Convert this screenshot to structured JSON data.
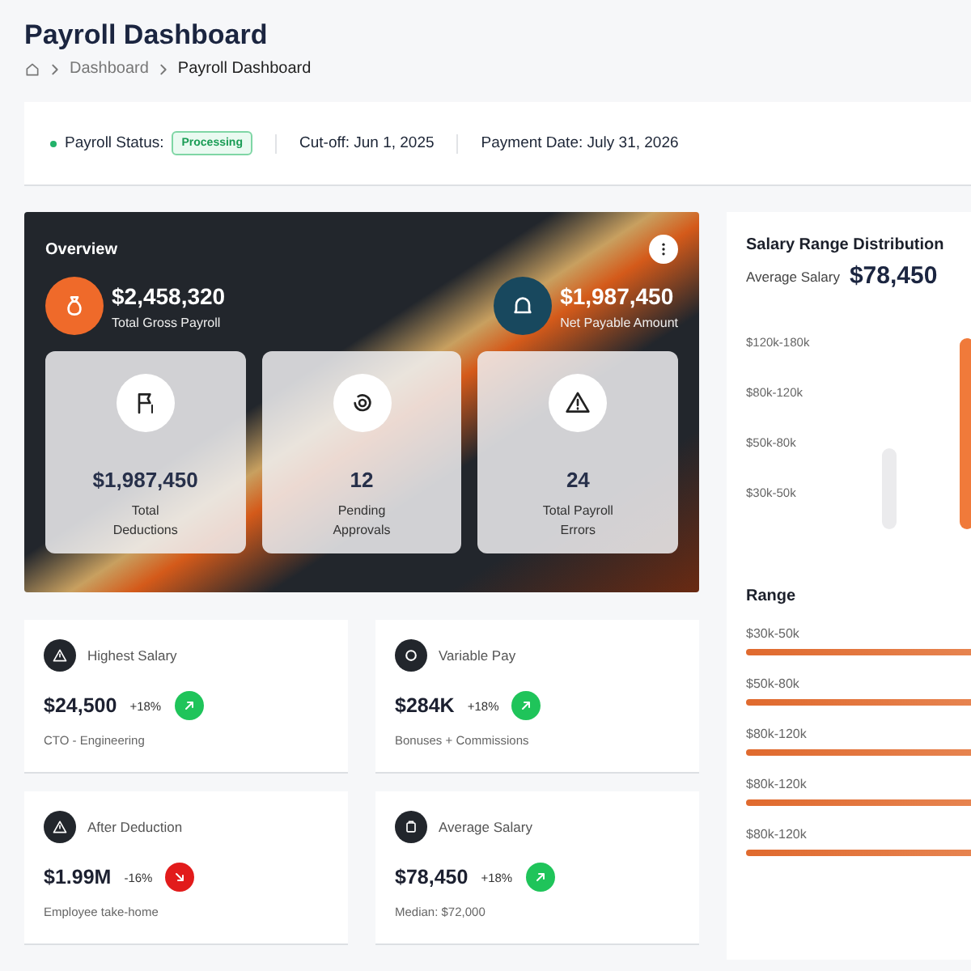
{
  "page": {
    "title": "Payroll Dashboard",
    "breadcrumb": [
      "Dashboard",
      "Payroll Dashboard"
    ]
  },
  "status_bar": {
    "status_label": "Payroll Status:",
    "status": "Processing",
    "cutoff": "Cut-off: Jun 1, 2025",
    "payment_date": "Payment Date: July 31, 2026"
  },
  "overview": {
    "title": "Overview",
    "summary": [
      {
        "kind": "gross",
        "value": "$2,458,320",
        "label": "Total Gross Payroll"
      },
      {
        "kind": "net",
        "value": "$1,987,450",
        "label": "Net Payable Amount"
      }
    ],
    "tiles": [
      {
        "kind": "deductions",
        "value": "$1,987,450",
        "label": "Total Deductions"
      },
      {
        "kind": "approvals",
        "value": "12",
        "label": "Pending Approvals"
      },
      {
        "kind": "errors",
        "value": "24",
        "label": "Total Payroll Errors"
      }
    ]
  },
  "stat_cards": [
    {
      "kind": "warning",
      "title": "Highest Salary",
      "value": "$24,500",
      "change": "+18%",
      "negative": false,
      "note": "CTO - Engineering"
    },
    {
      "kind": "coin",
      "title": "Variable Pay",
      "value": "$284K",
      "change": "+18%",
      "negative": false,
      "note": "Bonuses + Commissions"
    },
    {
      "kind": "warning",
      "title": "After Deduction",
      "value": "$1.99M",
      "change": "-16%",
      "negative": true,
      "note": "Employee take-home"
    },
    {
      "kind": "wallet",
      "title": "Average Salary",
      "value": "$78,450",
      "change": "+18%",
      "negative": false,
      "note": "Median: $72,000"
    }
  ],
  "distribution": {
    "title": "Salary Range Distribution",
    "average_label": "Average Salary",
    "average_value": "$78,450",
    "axis_labels": [
      "$120k-180k",
      "$80k-120k",
      "$50k-80k",
      "$30k-50k"
    ],
    "bars": [
      {
        "highlighted": false
      },
      {
        "highlighted": true
      }
    ]
  },
  "range": {
    "title": "Range",
    "items": [
      {
        "label": "$30k-50k"
      },
      {
        "label": "$50k-80k"
      },
      {
        "label": "$80k-120k"
      },
      {
        "label": "$80k-120k"
      },
      {
        "label": "$80k-120k"
      }
    ]
  }
}
